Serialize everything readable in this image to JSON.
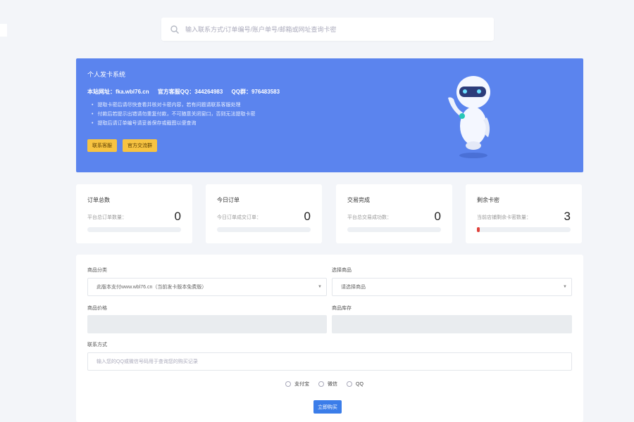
{
  "search": {
    "placeholder": "输入联系方式/订单编号/账户单号/邮箱或网址查询卡密"
  },
  "banner": {
    "title": "个人发卡系统",
    "site_label": "本站网址：",
    "site_value": "fka.wbl76.cn",
    "qq_label": "官方客服QQ：",
    "qq_value": "344264983",
    "group_label": "QQ群：",
    "group_value": "976483583",
    "notices": [
      "提取卡密后请尽快查看并核对卡密内容，若有问题请联系客服处理",
      "付款后若提示出错请勿重复付款，不可随意关闭窗口，否则无法提取卡密",
      "提取后请订单编号请妥善保存或截图以便查询"
    ],
    "buttons": [
      "联系客服",
      "官方交流群"
    ],
    "color": "#5b84ee"
  },
  "stats": [
    {
      "title": "订单总数",
      "label": "平台总订单数量：",
      "value": "0",
      "progress": 0
    },
    {
      "title": "今日订单",
      "label": "今日订单成交订单：",
      "value": "0",
      "progress": 0
    },
    {
      "title": "交易完成",
      "label": "平台总交易成功数：",
      "value": "0",
      "progress": 0
    },
    {
      "title": "剩余卡密",
      "label": "当前店铺剩余卡密数量：",
      "value": "3",
      "progress": 0.03
    }
  ],
  "form": {
    "category_label": "商品分类",
    "category_value": "此版本支付www.wbl76.cn（当前发卡版本免费版）",
    "product_label": "选择商品",
    "product_value": "请选择商品",
    "price_label": "商品价格",
    "stock_label": "商品库存",
    "contact_label": "联系方式",
    "contact_placeholder": "输入您的QQ或微信号码用于查询您的购买记录",
    "payments": [
      "支付宝",
      "微信",
      "QQ"
    ],
    "buy_button": "立即购买"
  }
}
